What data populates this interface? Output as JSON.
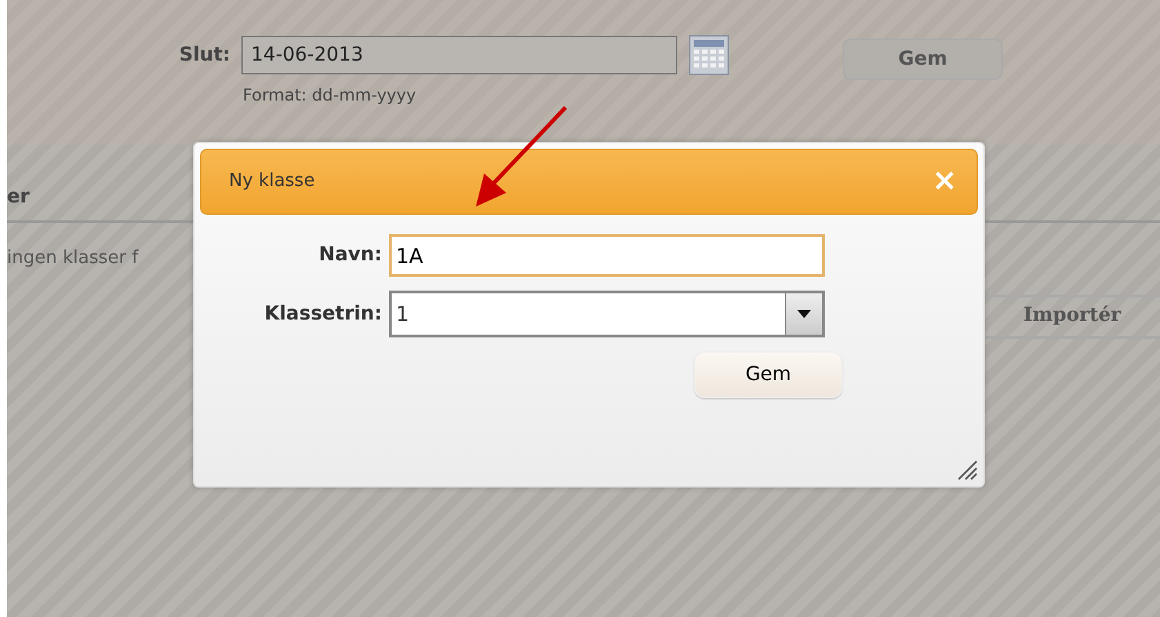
{
  "page": {
    "end_date": {
      "label": "Slut:",
      "value": "14-06-2013",
      "hint": "Format: dd-mm-yyyy"
    },
    "save_button": "Gem",
    "section_heading": "er",
    "empty_message": "ingen klasser f",
    "import_button": "Importér"
  },
  "dialog": {
    "title": "Ny klasse",
    "close": "×",
    "fields": [
      {
        "kind": "text",
        "label": "Navn:",
        "value": "1A",
        "focused": true
      },
      {
        "kind": "select",
        "label": "Klassetrin:",
        "value": "1",
        "focused": false
      }
    ],
    "save_button": "Gem"
  }
}
